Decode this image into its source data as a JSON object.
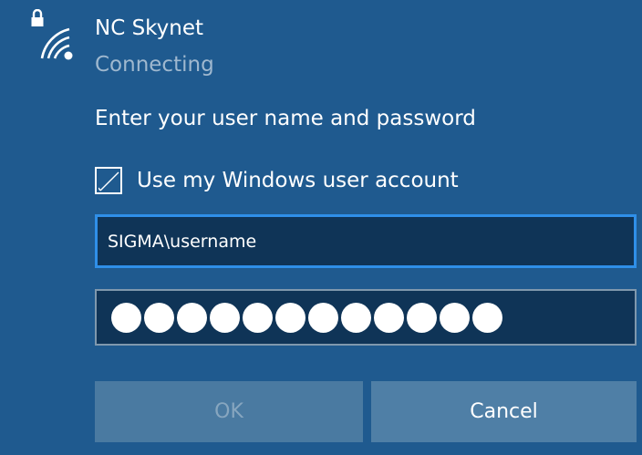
{
  "network": {
    "name": "NC Skynet",
    "status": "Connecting",
    "icon": "wifi-secured-icon"
  },
  "prompt": "Enter your user name and password",
  "checkbox": {
    "label": "Use my Windows user account",
    "checked": true
  },
  "username_field": {
    "value": "SIGMA\\username"
  },
  "password_field": {
    "mask_count": 12
  },
  "buttons": {
    "ok_label": "OK",
    "cancel_label": "Cancel"
  },
  "colors": {
    "background": "#1f5a8f",
    "field_bg": "#0f3457",
    "focus_border": "#2f8fe8",
    "status_text": "#9fb8cf"
  }
}
